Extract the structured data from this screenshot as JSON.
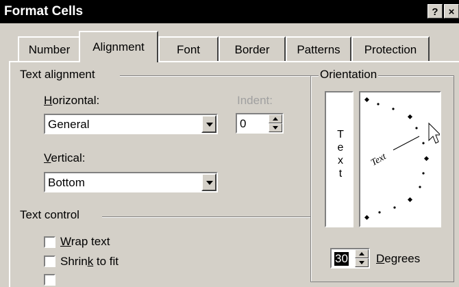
{
  "window": {
    "title": "Format Cells",
    "help_button": "?",
    "close_button": "×"
  },
  "tabs": [
    {
      "label": "Number"
    },
    {
      "label": "Alignment"
    },
    {
      "label": "Font"
    },
    {
      "label": "Border"
    },
    {
      "label": "Patterns"
    },
    {
      "label": "Protection"
    }
  ],
  "active_tab": "Alignment",
  "text_alignment": {
    "group_label": "Text alignment",
    "horizontal_label_pre": "",
    "horizontal_label_key": "H",
    "horizontal_label_post": "orizontal:",
    "horizontal_value": "General",
    "indent_label": "Indent:",
    "indent_value": "0",
    "vertical_label_key": "V",
    "vertical_label_post": "ertical:",
    "vertical_value": "Bottom"
  },
  "text_control": {
    "group_label": "Text control",
    "wrap_key": "W",
    "wrap_post": "rap text",
    "wrap_checked": false,
    "shrink_pre": "Shrin",
    "shrink_key": "k",
    "shrink_post": " to fit",
    "shrink_checked": false
  },
  "orientation": {
    "group_label": "Orientation",
    "vertical_text": [
      "T",
      "e",
      "x",
      "t"
    ],
    "dial_text": "Text",
    "degrees_value": "30",
    "degrees_key": "D",
    "degrees_post": "egrees"
  }
}
